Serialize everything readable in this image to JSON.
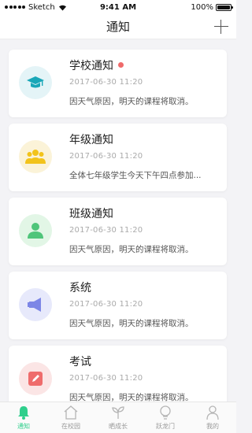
{
  "status_bar": {
    "carrier": "Sketch",
    "time": "9:41 AM",
    "battery": "100%"
  },
  "nav": {
    "title": "通知",
    "add_icon": "plus-icon"
  },
  "notifications": [
    {
      "title": "学校通知",
      "time": "2017-06-30   11:20",
      "content": "因天气原因，明天的课程将取消。",
      "icon": "graduation-cap-icon",
      "color": "#1aa7b8",
      "bg": "#e4f4f7",
      "unread": true
    },
    {
      "title": "年级通知",
      "time": "2017-06-30   11:20",
      "content": "全体七年级学生今天下午四点参加...",
      "icon": "group-icon",
      "color": "#f2c31a",
      "bg": "#fbf3d8",
      "unread": false
    },
    {
      "title": "班级通知",
      "time": "2017-06-30   11:20",
      "content": "因天气原因，明天的课程将取消。",
      "icon": "user-icon",
      "color": "#4fc57a",
      "bg": "#e2f6e6",
      "unread": false
    },
    {
      "title": "系统",
      "time": "2017-06-30   11:20",
      "content": "因天气原因，明天的课程将取消。",
      "icon": "speaker-icon",
      "color": "#7c86e6",
      "bg": "#e7e9fb",
      "unread": false
    },
    {
      "title": "考试",
      "time": "2017-06-30   11:20",
      "content": "因天气原因，明天的课程将取消。",
      "icon": "pencil-icon",
      "color": "#ef6c6c",
      "bg": "#fbe5e5",
      "unread": false
    }
  ],
  "tabs": [
    {
      "label": "通知",
      "icon": "bell-icon",
      "active": true
    },
    {
      "label": "在校园",
      "icon": "home-icon",
      "active": false
    },
    {
      "label": "晒成长",
      "icon": "sprout-icon",
      "active": false
    },
    {
      "label": "跃龙门",
      "icon": "lightbulb-icon",
      "active": false
    },
    {
      "label": "我的",
      "icon": "person-icon",
      "active": false
    }
  ],
  "colors": {
    "accent": "#2fcf8c",
    "unread_dot": "#ef6a6a"
  }
}
